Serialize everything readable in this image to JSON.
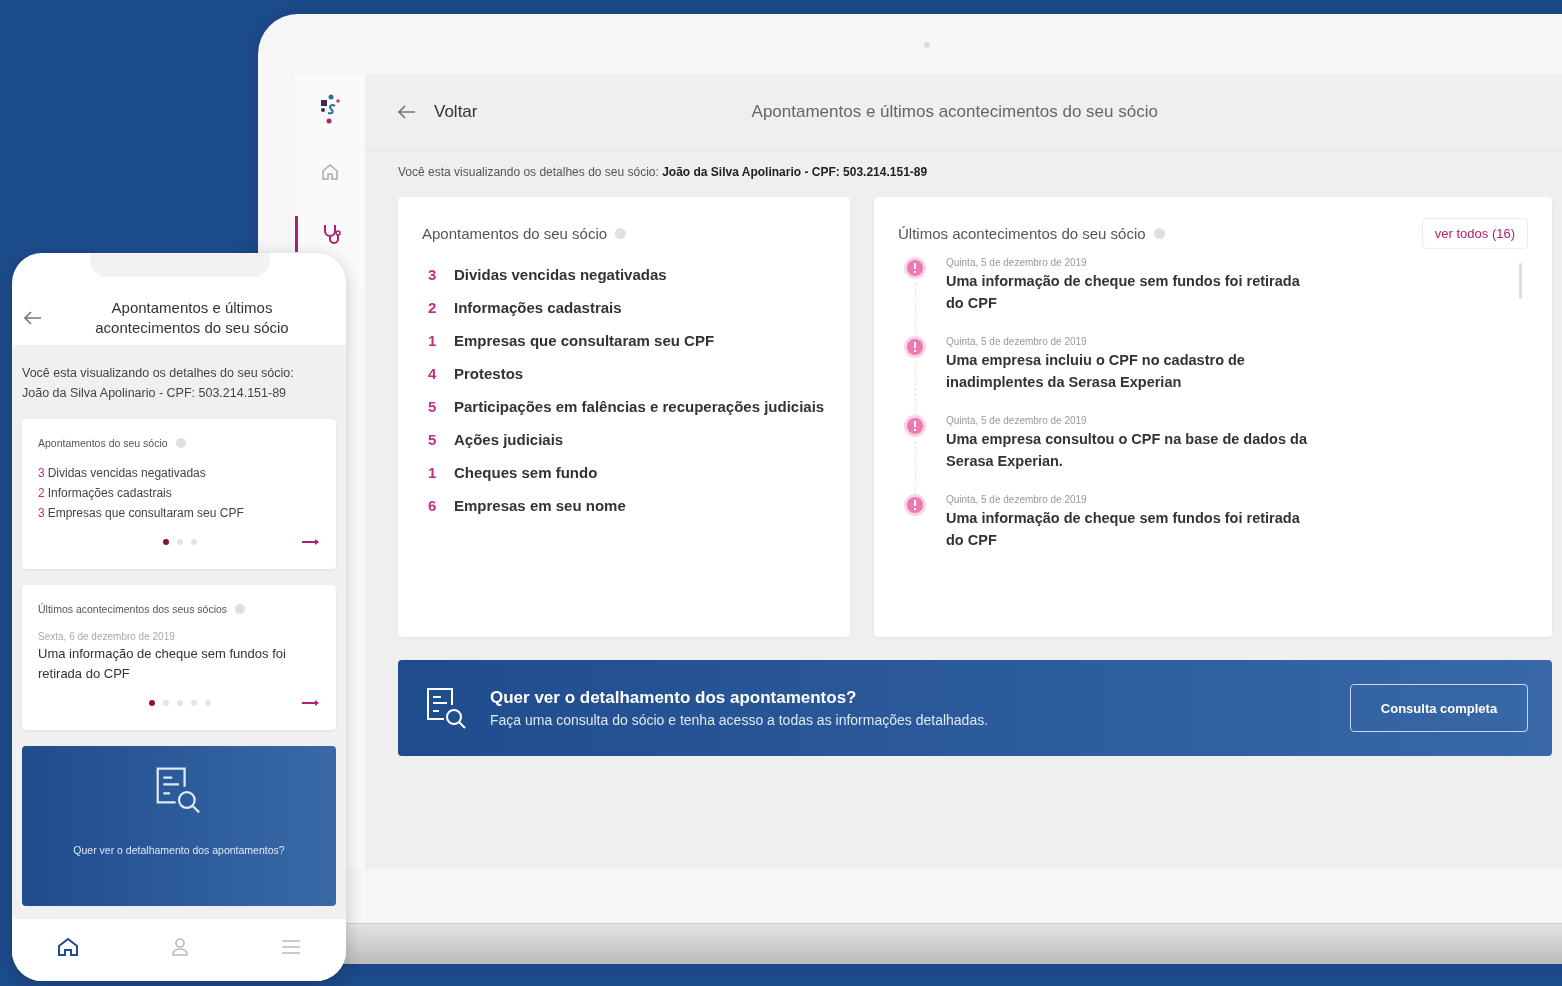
{
  "desktop": {
    "sidebar": {
      "items": [
        {
          "kind": "home",
          "selected": false
        },
        {
          "kind": "stethoscope",
          "selected": true
        }
      ]
    },
    "header": {
      "back": "Voltar",
      "title": "Apontamentos e últimos acontecimentos do seu sócio"
    },
    "info": "Você esta visualizando os detalhes do seu sócio: **João da Silva Apolinario - CPF: 503.214.151-89**",
    "apontamentos": {
      "title": "Apontamentos do seu sócio",
      "items": [
        {
          "count": "3",
          "label": "Dividas vencidas negativadas"
        },
        {
          "count": "2",
          "label": "Informações cadastrais"
        },
        {
          "count": "1",
          "label": "Empresas que consultaram seu CPF"
        },
        {
          "count": "4",
          "label": "Protestos"
        },
        {
          "count": "5",
          "label": "Participações em falências e recuperações judiciais"
        },
        {
          "count": "5",
          "label": "Ações judiciais"
        },
        {
          "count": "1",
          "label": "Cheques sem fundo"
        },
        {
          "count": "6",
          "label": "Empresas em seu nome"
        }
      ]
    },
    "acontecimentos": {
      "title": "Últimos acontecimentos do seu sócio",
      "button": "ver todos (16)",
      "events": [
        {
          "date": "Quinta, 5 de dezembro de 2019",
          "text": "Uma informação de cheque sem fundos foi retirada do CPF"
        },
        {
          "date": "Quinta, 5 de dezembro de 2019",
          "text": "Uma empresa incluiu o CPF no cadastro de inadimplentes da Serasa Experian"
        },
        {
          "date": "Quinta, 5 de dezembro de 2019",
          "text": "Uma empresa consultou o CPF na base de dados da Serasa Experian."
        },
        {
          "date": "Quinta, 5 de dezembro de 2019",
          "text": "Uma informação de cheque sem fundos foi retirada do CPF"
        }
      ]
    },
    "banner": {
      "title": "Quer ver o detalhamento dos apontamentos?",
      "subtitle": "Faça uma consulta do sócio e tenha acesso a todas as informações detalhadas.",
      "button": "Consulta completa"
    }
  },
  "phone": {
    "header": {
      "title": "Apontamentos e últimos acontecimentos do seu sócio"
    },
    "info": "Você esta visualizando os detalhes do seu sócio: João da Silva Apolinario - CPF: 503.214.151-89",
    "apontamentos": {
      "title": "Apontamentos do seu sócio",
      "items": [
        {
          "count": "3",
          "label": "Dividas vencidas negativadas"
        },
        {
          "count": "2",
          "label": "Informações cadastrais"
        },
        {
          "count": "3",
          "label": "Empresas que consultaram seu CPF"
        }
      ],
      "dots": [
        {
          "selected": true
        },
        {
          "selected": false
        },
        {
          "selected": false
        }
      ]
    },
    "acontecimentos": {
      "title": "Últimos acontecimentos dos seus sócios",
      "date": "Sexta, 6 de dezembro de 2019",
      "text": "Uma informação de cheque sem fundos foi retirada do CPF",
      "dots": [
        {
          "selected": true
        },
        {
          "selected": false
        },
        {
          "selected": false
        },
        {
          "selected": false
        },
        {
          "selected": false
        }
      ]
    },
    "banner": {
      "title": "Quer ver o detalhamento dos apontamentos?"
    },
    "nav": [
      {
        "kind": "home",
        "selected": true
      },
      {
        "kind": "person",
        "selected": false
      },
      {
        "kind": "menu",
        "selected": false
      }
    ]
  }
}
